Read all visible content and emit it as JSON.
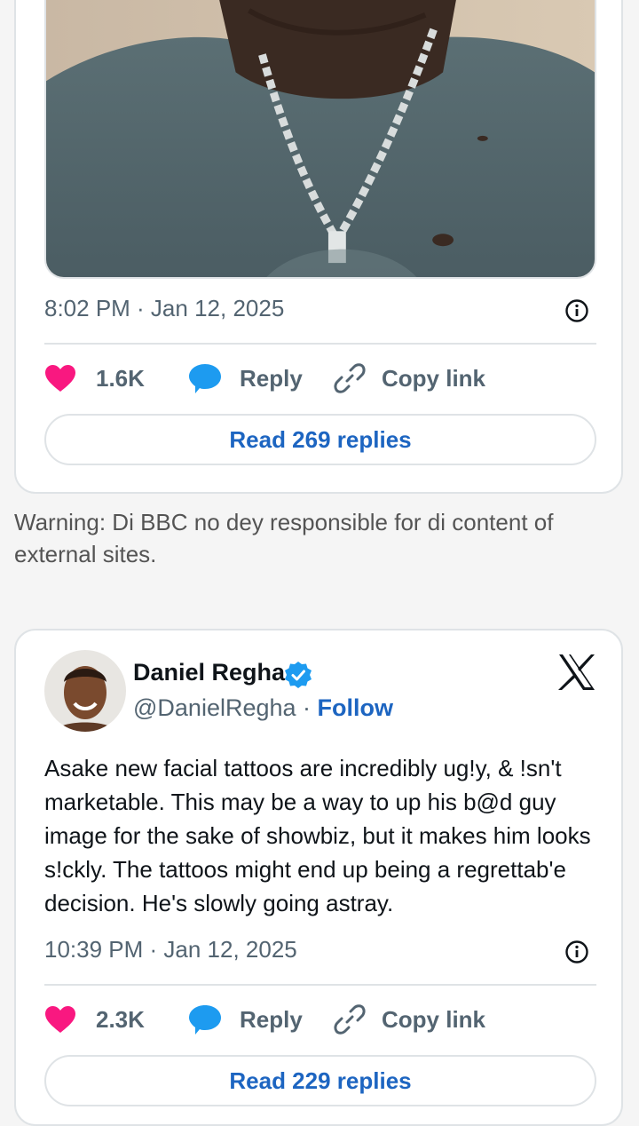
{
  "tweet1": {
    "timestamp": "8:02 PM · Jan 12, 2025",
    "likes": "1.6K",
    "reply_label": "Reply",
    "copy_label": "Copy link",
    "read_replies": "Read 269 replies"
  },
  "warning": "Warning: Di BBC no dey responsible for di content of external sites.",
  "tweet2": {
    "author_name": "Daniel Regha",
    "handle": "@DanielRegha",
    "separator": " · ",
    "follow_label": "Follow",
    "text": "Asake new facial tattoos are incredibly ug!y, & !sn't marketable. This may be a way to up his b@d guy image for the sake of showbiz, but it makes him looks s!ckly. The tattoos might end up being a regrettab'e decision. He's slowly going astray.",
    "timestamp": "10:39 PM · Jan 12, 2025",
    "likes": "2.3K",
    "reply_label": "Reply",
    "copy_label": "Copy link",
    "read_replies": "Read 229 replies"
  },
  "colors": {
    "like": "#f91880",
    "reply": "#1d9bf0",
    "link_blue": "#1d65c1",
    "muted": "#536471",
    "border": "#dfe3e6"
  },
  "icons": [
    "heart-icon",
    "reply-bubble-icon",
    "link-icon",
    "info-icon",
    "verified-badge-icon",
    "x-logo-icon"
  ]
}
